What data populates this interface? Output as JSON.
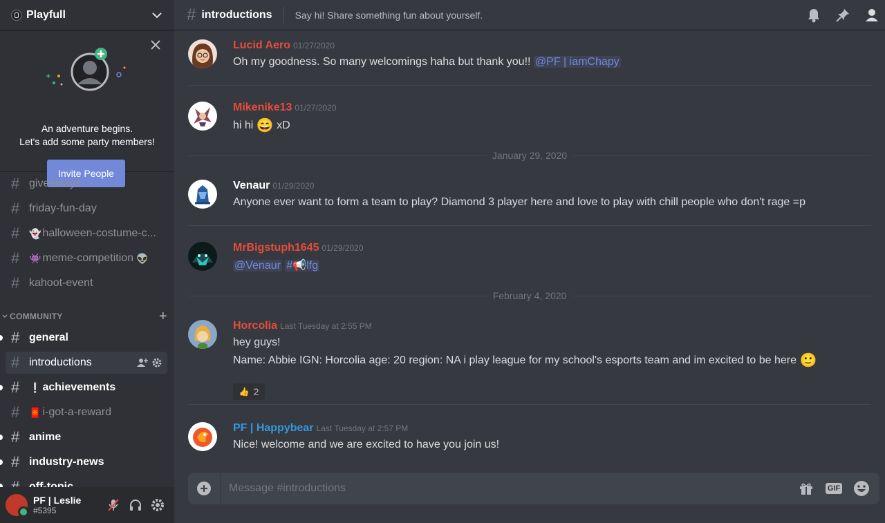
{
  "server": {
    "name": "Playfull"
  },
  "invite": {
    "line1": "An adventure begins.",
    "line2": "Let's add some party members!",
    "button": "Invite People"
  },
  "channels_top": [
    {
      "name": "giveaways",
      "emoji": ""
    },
    {
      "name": "friday-fun-day",
      "emoji": ""
    },
    {
      "name": "halloween-costume-c...",
      "emoji": "👻"
    },
    {
      "name": "meme-competition",
      "emoji": "👾",
      "suffix": "👽"
    },
    {
      "name": "kahoot-event",
      "emoji": ""
    }
  ],
  "category": {
    "name": "COMMUNITY"
  },
  "channels_community": [
    {
      "name": "general",
      "unread": true
    },
    {
      "name": "introductions",
      "active": true
    },
    {
      "name": "achievements",
      "emoji": "❕",
      "unread": true
    },
    {
      "name": "i-got-a-reward",
      "emoji": "🧧"
    },
    {
      "name": "anime",
      "unread": true
    },
    {
      "name": "industry-news",
      "unread": true
    },
    {
      "name": "off-topic",
      "unread": true
    }
  ],
  "user": {
    "name": "PF | Leslie",
    "tag": "#5395"
  },
  "topbar": {
    "channel": "introductions",
    "topic": "Say hi! Share something fun about yourself."
  },
  "messages": [
    {
      "author": "Lucid Aero",
      "color": "#f04747",
      "time": "01/27/2020",
      "text": "Oh my goodness. So many welcomings haha but thank you!! ",
      "mention": "@PF | iamChapy"
    },
    {
      "author": "Mikenike13",
      "color": "#f04747",
      "time": "01/27/2020",
      "text_a": "hi hi ",
      "emoji": "😄",
      "text_b": " xD"
    },
    {
      "author": "Venaur",
      "color": "#ffffff",
      "time": "01/29/2020",
      "text": "Anyone ever want to form a team to play? Diamond 3 player here and love to play with chill people who don't rage =p"
    },
    {
      "author": "MrBigstuph1645",
      "color": "#f04747",
      "time": "01/29/2020",
      "mention1": "@Venaur",
      "mention2": "#📢lfg"
    },
    {
      "author": "Horcolia",
      "color": "#f04747",
      "time": "Last Tuesday at 2:55 PM",
      "line1": "hey guys!",
      "line2": "Name: Abbie IGN: Horcolia age: 20 region: NA i play league for my school's esports team and im excited to be here ",
      "emoji": "🙂",
      "reaction_emoji": "👍",
      "reaction_count": "2"
    },
    {
      "author": "PF | Happybear",
      "color": "#3498db",
      "time": "Last Tuesday at 2:57 PM",
      "text": "Nice! welcome and we are excited to have you join us!"
    }
  ],
  "dates": [
    "January 29, 2020",
    "February 4, 2020"
  ],
  "composer": {
    "placeholder": "Message #introductions",
    "gif": "GIF"
  }
}
